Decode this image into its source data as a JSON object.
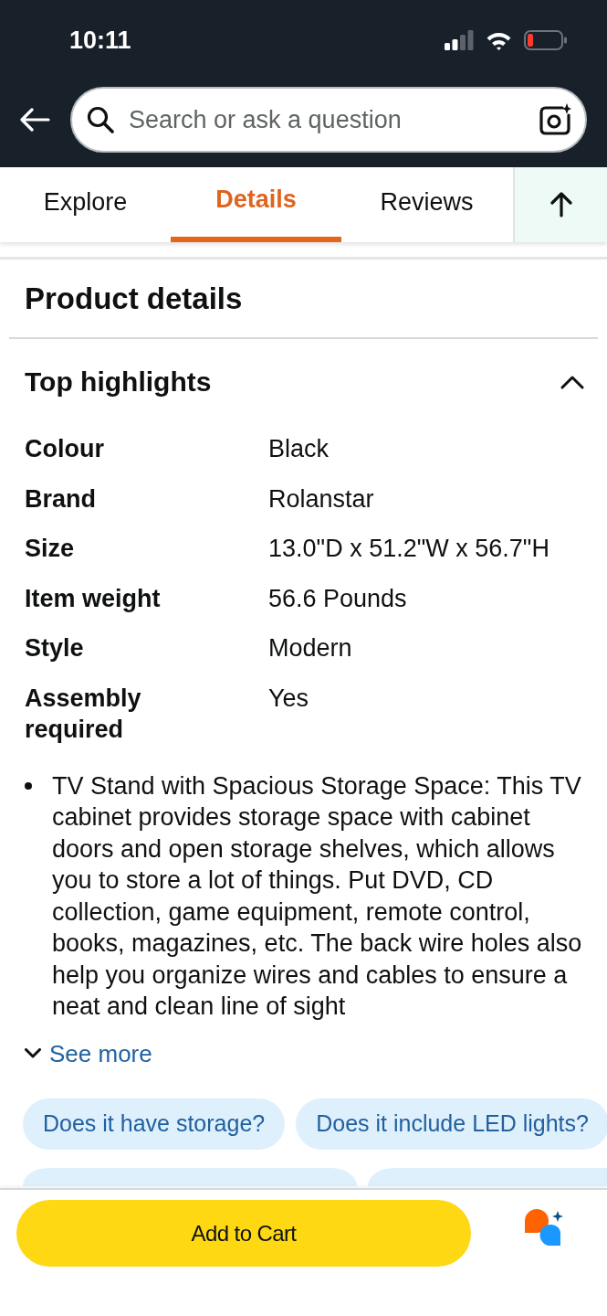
{
  "status_bar": {
    "time": "10:11"
  },
  "search": {
    "placeholder": "Search or ask a question"
  },
  "tabs": [
    {
      "label": "Explore",
      "selected": false
    },
    {
      "label": "Details",
      "selected": true
    },
    {
      "label": "Reviews",
      "selected": false
    }
  ],
  "product_details": {
    "title": "Product details"
  },
  "top_highlights": {
    "title": "Top highlights",
    "expanded": true,
    "rows": [
      {
        "label": "Colour",
        "value": "Black"
      },
      {
        "label": "Brand",
        "value": "Rolanstar"
      },
      {
        "label": "Size",
        "value": "13.0\"D x 51.2\"W x 56.7\"H"
      },
      {
        "label": "Item weight",
        "value": "56.6 Pounds"
      },
      {
        "label": "Style",
        "value": "Modern"
      },
      {
        "label": "Assembly required",
        "value": "Yes"
      }
    ],
    "bullets": [
      "TV Stand with Spacious Storage Space: This TV cabinet provides storage space with cabinet doors and open storage shelves, which allows you to store a lot of things. Put DVD, CD collection, game equipment, remote control, books, magazines, etc. The back wire holes also help you organize wires and cables to ensure a neat and clean line of sight"
    ],
    "see_more": "See more"
  },
  "suggested_questions": [
    {
      "text": "Does it have storage?"
    },
    {
      "text": "Does it include LED lights?"
    }
  ],
  "bottom_bar": {
    "button": "Add to Cart"
  }
}
